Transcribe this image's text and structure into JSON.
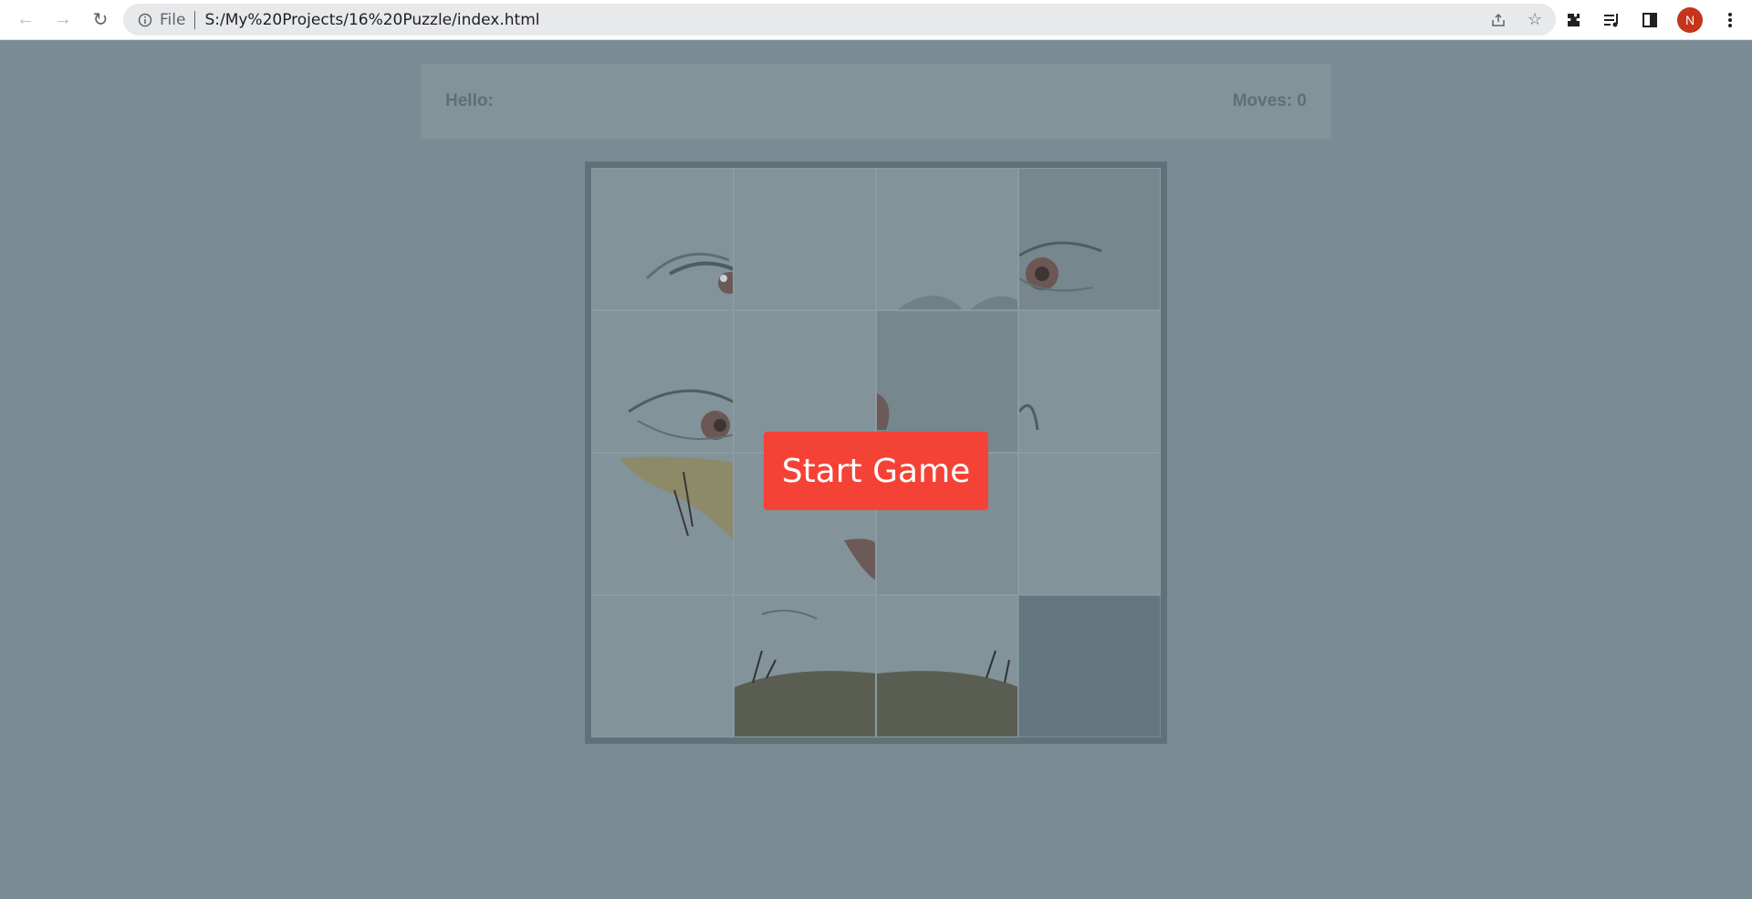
{
  "browser": {
    "file_label": "File",
    "url": "S:/My%20Projects/16%20Puzzle/index.html",
    "avatar_initial": "N"
  },
  "header": {
    "hello_label": "Hello:",
    "moves_label": "Moves: 0"
  },
  "game": {
    "start_button_label": "Start Game",
    "tiles": [
      {
        "content": "eye-left-top"
      },
      {
        "content": "skin"
      },
      {
        "content": "nose-top"
      },
      {
        "content": "eye-right-top"
      },
      {
        "content": "eye-left-bottom"
      },
      {
        "content": "skin"
      },
      {
        "content": "nose-moth"
      },
      {
        "content": "eye-right-bottom"
      },
      {
        "content": "moth-wing"
      },
      {
        "content": "skin-moth"
      },
      {
        "content": "cheek"
      },
      {
        "content": "cheek"
      },
      {
        "content": "skin"
      },
      {
        "content": "moth-lips-left"
      },
      {
        "content": "moth-lips-right"
      },
      {
        "content": "empty"
      }
    ]
  },
  "colors": {
    "overlay_bg": "#7a8c93",
    "start_button": "#f44336"
  }
}
